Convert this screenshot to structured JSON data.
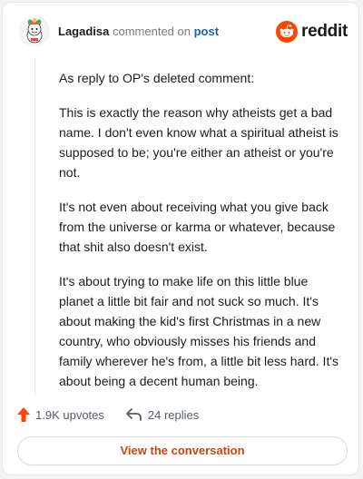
{
  "header": {
    "username": "Lagadisa",
    "action_text": "commented on",
    "post_link": "post",
    "brand_name": "reddit",
    "avatar_icon": "avatar-icon",
    "brand_icon": "reddit-logo-icon"
  },
  "comment": {
    "paragraphs": [
      "As reply to OP's deleted comment:",
      "This is exactly the reason why atheists get a bad name. I don't even know what a spiritual atheist is supposed to be; you're either an atheist or you're not.",
      "It's not even about receiving what you give back from the universe or karma or whatever, because that shit also doesn't exist.",
      "It's about trying to make life on this little blue planet a little bit fair and not suck so much. It's about making the kid's first Christmas in a new country, who obviously misses his friends and family wherever he's from, a little bit less hard. It's about being a decent human being."
    ]
  },
  "stats": {
    "upvotes": "1.9K upvotes",
    "replies": "24 replies",
    "upvote_icon": "upvote-arrow-icon",
    "reply_icon": "reply-arrow-icon"
  },
  "cta": {
    "label": "View the conversation"
  },
  "colors": {
    "brand_orange": "#ff4500",
    "link_blue": "#1d5fb5",
    "cta_text": "#c4470e",
    "upvote_orange": "#ff4500"
  }
}
